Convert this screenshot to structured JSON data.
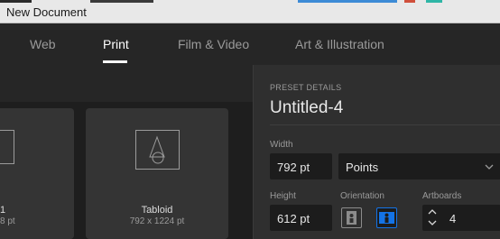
{
  "window": {
    "title": "New Document"
  },
  "tabs": [
    {
      "label": "Web",
      "active": false
    },
    {
      "label": "Print",
      "active": true
    },
    {
      "label": "Film & Video",
      "active": false
    },
    {
      "label": "Art & Illustration",
      "active": false
    }
  ],
  "presets": [
    {
      "title": "1",
      "size": "8 pt",
      "partial": true
    },
    {
      "title": "Tabloid",
      "size": "792 x 1224 pt",
      "partial": false
    }
  ],
  "details": {
    "section_label": "PRESET DETAILS",
    "name": "Untitled-4",
    "width_label": "Width",
    "width_value": "792 pt",
    "units_value": "Points",
    "height_label": "Height",
    "height_value": "612 pt",
    "orientation_label": "Orientation",
    "artboards_label": "Artboards",
    "artboards_value": "4",
    "orientation_selected": "landscape"
  },
  "colors": {
    "accent": "#1473e6",
    "panel_bg": "#2f2f2f",
    "field_bg": "#1c1c1c"
  },
  "icons": [
    "chevron-down-icon",
    "portrait-icon",
    "landscape-icon",
    "stepper-icon",
    "shapes-icon"
  ]
}
